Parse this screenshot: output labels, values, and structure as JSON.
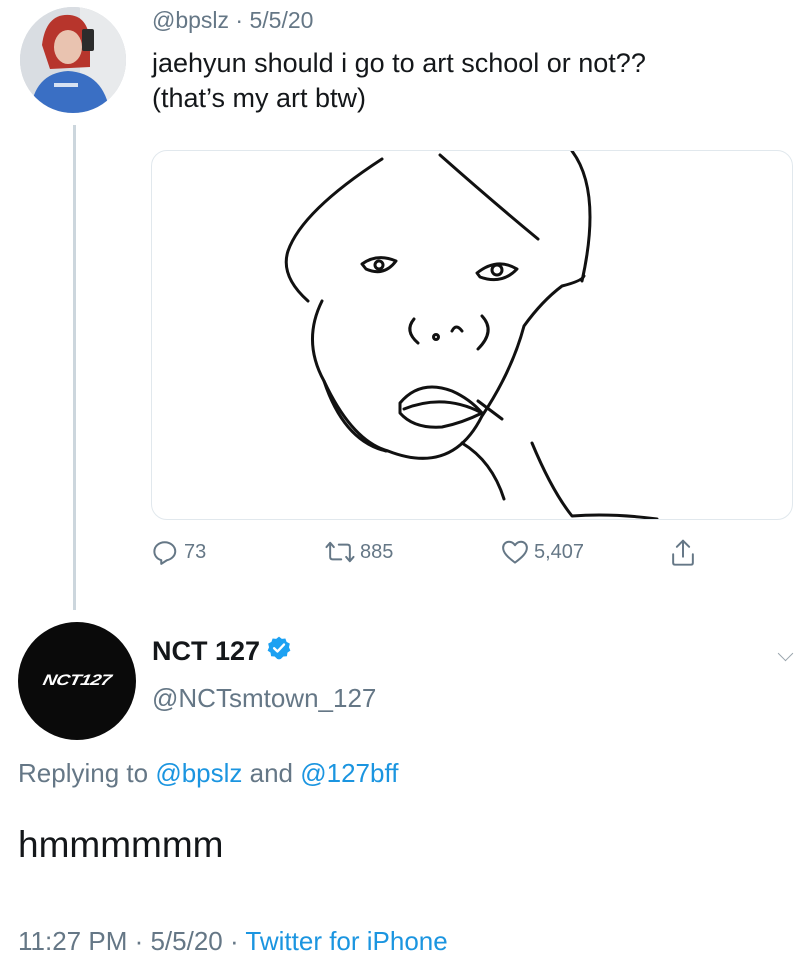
{
  "tweet": {
    "handle": "@bpslz",
    "date_sep": " · ",
    "date": "5/5/20",
    "text_line1": "jaehyun should i go to art school or not??",
    "text_line2": "(that’s my art btw)",
    "stats": {
      "replies": "73",
      "retweets": "885",
      "likes": "5,407"
    }
  },
  "reply": {
    "logo_text": "NCT127",
    "name": "NCT 127",
    "handle": "@NCTsmtown_127",
    "replying_prefix": "Replying to ",
    "replying_user1": "@bpslz",
    "replying_and": " and ",
    "replying_user2": "@127bff",
    "text": "hmmmmmm",
    "time": "11:27 PM",
    "sep1": " · ",
    "date": "5/5/20",
    "sep2": " · ",
    "source": "Twitter for iPhone"
  },
  "icons": {
    "reply": "reply-icon",
    "retweet": "retweet-icon",
    "like": "heart-icon",
    "share": "share-icon",
    "verified": "verified-badge-icon"
  },
  "colors": {
    "text": "#14171a",
    "secondary": "#657786",
    "link": "#1b95e0",
    "verified": "#1da1f2",
    "divider": "#ccd6dd"
  }
}
